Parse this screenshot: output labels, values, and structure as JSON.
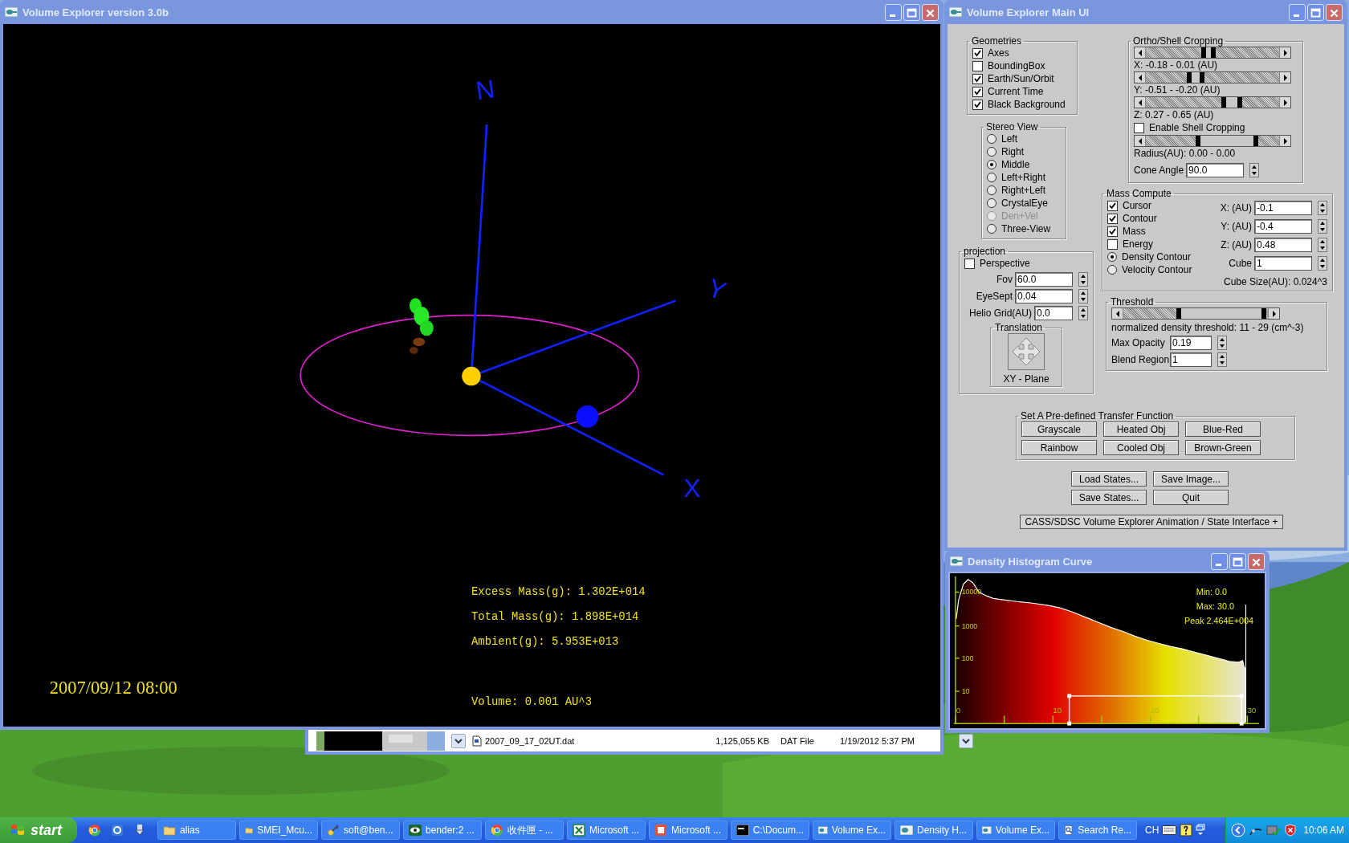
{
  "viewer": {
    "title": "Volume Explorer version 3.0b",
    "axes": [
      {
        "label": "N"
      },
      {
        "label": "Y"
      },
      {
        "label": "X"
      }
    ],
    "readouts": [
      "Excess Mass(g): 1.302E+014",
      "Total Mass(g): 1.898E+014",
      "Ambient(g): 5.953E+013",
      "Volume: 0.001 AU^3"
    ],
    "timestamp": "2007/09/12 08:00"
  },
  "file_list": {
    "row": {
      "name": "2007_09_17_02UT.dat",
      "size": "1,125,055 KB",
      "type": "DAT File",
      "modified": "1/19/2012 5:37 PM"
    }
  },
  "main_ui": {
    "title": "Volume Explorer Main UI",
    "geometries": {
      "title": "Geometries",
      "items": [
        {
          "label": "Axes",
          "checked": true
        },
        {
          "label": "BoundingBox",
          "checked": false
        },
        {
          "label": "Earth/Sun/Orbit",
          "checked": true
        },
        {
          "label": "Current Time",
          "checked": true
        },
        {
          "label": "Black Background",
          "checked": true
        }
      ]
    },
    "stereo_view": {
      "title": "Stereo View",
      "options": [
        {
          "label": "Left",
          "selected": false,
          "disabled": false
        },
        {
          "label": "Right",
          "selected": false,
          "disabled": false
        },
        {
          "label": "Middle",
          "selected": true,
          "disabled": false
        },
        {
          "label": "Left+Right",
          "selected": false,
          "disabled": false
        },
        {
          "label": "Right+Left",
          "selected": false,
          "disabled": false
        },
        {
          "label": "CrystalEye",
          "selected": false,
          "disabled": false
        },
        {
          "label": "Den+Vel",
          "selected": false,
          "disabled": true
        },
        {
          "label": "Three-View",
          "selected": false,
          "disabled": false
        }
      ]
    },
    "projection": {
      "title": "projection",
      "perspective": {
        "label": "Perspective",
        "checked": false
      },
      "fields": [
        {
          "label": "Fov",
          "value": "60.0"
        },
        {
          "label": "EyeSept",
          "value": "0.04"
        },
        {
          "label": "Helio Grid(AU)",
          "value": "0.0"
        }
      ],
      "translation": {
        "title": "Translation",
        "label": "XY - Plane"
      }
    },
    "cropping": {
      "title": "Ortho/Shell Cropping",
      "sliders": [
        {
          "handles": [
            {
              "level": 0.44
            },
            {
              "level": 0.51
            }
          ],
          "reading": "X: -0.18 - 0.01 (AU)"
        },
        {
          "handles": [
            {
              "level": 0.33
            },
            {
              "level": 0.43
            }
          ],
          "reading": "Y: -0.51 - -0.20 (AU)"
        },
        {
          "handles": [
            {
              "level": 0.59
            },
            {
              "level": 0.71
            }
          ],
          "reading": "Z: 0.27 - 0.65 (AU)"
        }
      ],
      "shell": {
        "label": "Enable Shell Cropping",
        "checked": false
      },
      "radius_slider": {
        "handles": [
          {
            "level": 0.4
          },
          {
            "level": 0.83
          }
        ],
        "reading": "Radius(AU): 0.00 - 0.00"
      },
      "cone_angle": {
        "label": "Cone Angle",
        "value": "90.0"
      }
    },
    "mass_compute": {
      "title": "Mass Compute",
      "checkboxes": [
        {
          "label": "Cursor",
          "checked": true
        },
        {
          "label": "Contour",
          "checked": true
        },
        {
          "label": "Mass",
          "checked": true
        },
        {
          "label": "Energy",
          "checked": false
        }
      ],
      "contour_mode": [
        {
          "label": "Density Contour",
          "selected": true
        },
        {
          "label": "Velocity Contour",
          "selected": false
        }
      ],
      "fields": [
        {
          "label": "X: (AU)",
          "value": "-0.1"
        },
        {
          "label": "Y: (AU)",
          "value": "-0.4"
        },
        {
          "label": "Z: (AU)",
          "value": "0.48"
        },
        {
          "label": "Cube",
          "value": "1"
        }
      ],
      "cube_size": "Cube Size(AU): 0.024^3"
    },
    "threshold": {
      "title": "Threshold",
      "slider": {
        "handles": [
          {
            "level": 0.39
          },
          {
            "level": 0.98
          }
        ]
      },
      "reading": "normalized density threshold: 11 - 29 (cm^-3)",
      "fields": [
        {
          "label": "Max Opacity",
          "value": "0.19"
        },
        {
          "label": "Blend Region",
          "value": "1"
        }
      ]
    },
    "transfer_function": {
      "title": "Set A Pre-defined Transfer Function",
      "buttons": [
        "Grayscale",
        "Heated Obj",
        "Blue-Red",
        "Rainbow",
        "Cooled Obj",
        "Brown-Green"
      ]
    },
    "state_buttons": [
      "Load States...",
      "Save Image...",
      "Save States...",
      "Quit"
    ],
    "animation_bar": "CASS/SDSC Volume Explorer Animation / State Interface +"
  },
  "histogram": {
    "title": "Density Histogram Curve",
    "y_labels": [
      "10000",
      "1000",
      "100",
      "10"
    ],
    "x_labels": [
      "0",
      "10",
      "20",
      "30"
    ],
    "stats": [
      "Min: 0.0",
      "Max: 30.0",
      "Peak 2.464E+004"
    ]
  },
  "taskbar": {
    "start": "start",
    "tasks": [
      "alias",
      "SMEI_Mcu...",
      "soft@ben...",
      "bender:2 ...",
      "收件匣 - ...",
      "Microsoft ...",
      "Microsoft ...",
      "C:\\Docum...",
      "Volume Ex...",
      "Density H...",
      "Volume Ex...",
      "Search Re..."
    ],
    "language": "CH",
    "clock": "10:06 AM"
  }
}
